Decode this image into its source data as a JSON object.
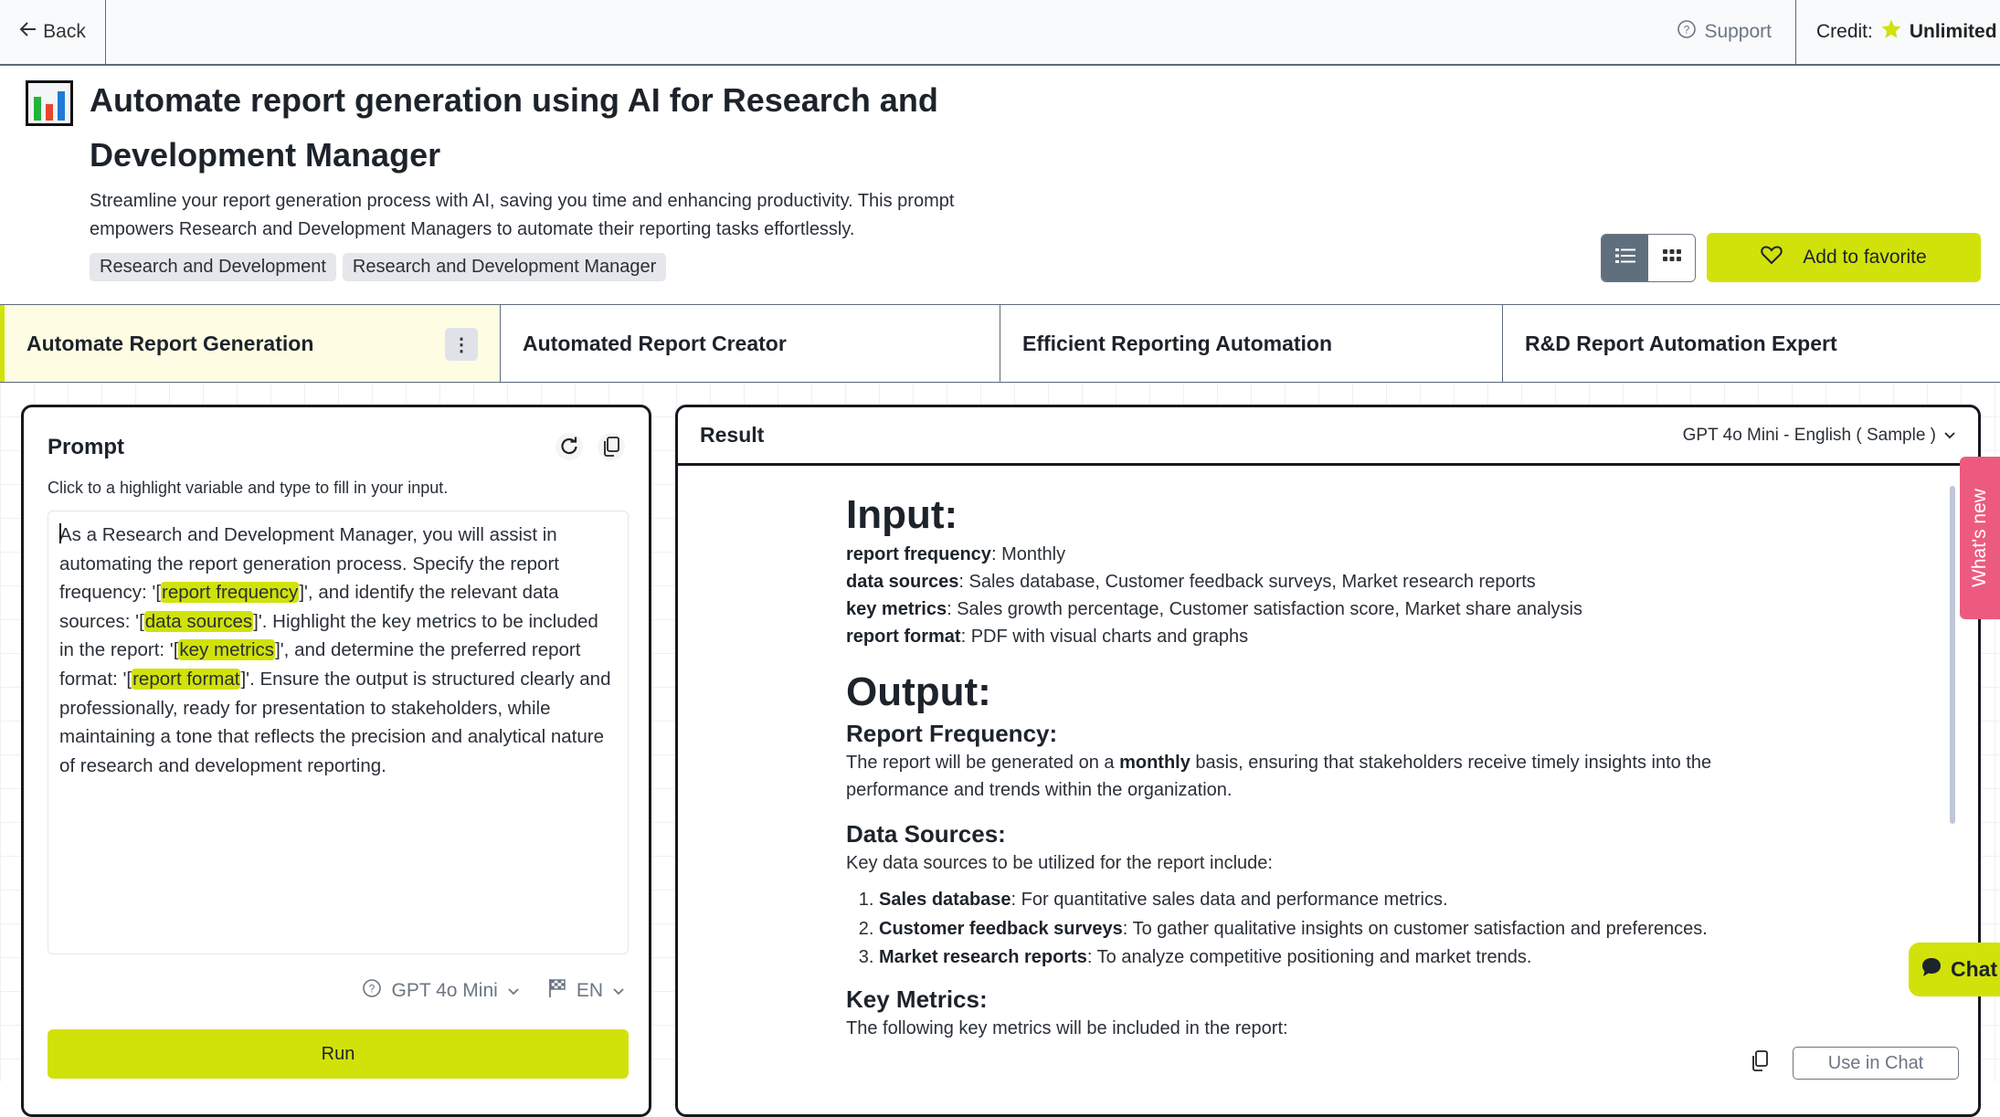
{
  "topbar": {
    "back_label": "Back",
    "support_label": "Support",
    "credit_label": "Credit:",
    "credit_value": "Unlimited"
  },
  "header": {
    "title": "Automate report generation using AI for Research and Development Manager",
    "description": "Streamline your report generation process with AI, saving you time and enhancing productivity. This prompt empowers Research and Development Managers to automate their reporting tasks effortlessly.",
    "tags": [
      "Research and Development",
      "Research and Development Manager"
    ],
    "favorite_label": "Add to favorite"
  },
  "tabs": [
    {
      "label": "Automate Report Generation",
      "active": true
    },
    {
      "label": "Automated Report Creator",
      "active": false
    },
    {
      "label": "Efficient Reporting Automation",
      "active": false
    },
    {
      "label": "R&D Report Automation Expert",
      "active": false
    }
  ],
  "prompt": {
    "title": "Prompt",
    "hint": "Click to a highlight variable and type to fill in your input.",
    "segments": [
      {
        "t": "As a Research and Development Manager, you will assist in automating the report generation process. Specify the report frequency: '["
      },
      {
        "v": "report frequency"
      },
      {
        "t": "]', and identify the relevant data sources: '["
      },
      {
        "v": "data sources"
      },
      {
        "t": "]'. Highlight the key metrics to be included in the report: '["
      },
      {
        "v": "key metrics"
      },
      {
        "t": "]', and determine the preferred report format: '["
      },
      {
        "v": "report format"
      },
      {
        "t": "]'. Ensure the output is structured clearly and professionally, ready for presentation to stakeholders, while maintaining a tone that reflects the precision and analytical nature of research and development reporting."
      }
    ],
    "model": "GPT 4o Mini",
    "language": "EN",
    "run_label": "Run"
  },
  "result": {
    "title": "Result",
    "model_selector": "GPT 4o Mini - English ( Sample )",
    "input_heading": "Input:",
    "inputs": [
      {
        "key": "report frequency",
        "value": "Monthly"
      },
      {
        "key": "data sources",
        "value": "Sales database, Customer feedback surveys, Market research reports"
      },
      {
        "key": "key metrics",
        "value": "Sales growth percentage, Customer satisfaction score, Market share analysis"
      },
      {
        "key": "report format",
        "value": "PDF with visual charts and graphs"
      }
    ],
    "output_heading": "Output:",
    "report_frequency_heading": "Report Frequency:",
    "report_frequency_pre": "The report will be generated on a ",
    "report_frequency_bold": "monthly",
    "report_frequency_post": " basis, ensuring that stakeholders receive timely insights into the performance and trends within the organization.",
    "data_sources_heading": "Data Sources:",
    "data_sources_intro": "Key data sources to be utilized for the report include:",
    "data_sources": [
      {
        "name": "Sales database",
        "desc": "For quantitative sales data and performance metrics."
      },
      {
        "name": "Customer feedback surveys",
        "desc": "To gather qualitative insights on customer satisfaction and preferences."
      },
      {
        "name": "Market research reports",
        "desc": "To analyze competitive positioning and market trends."
      }
    ],
    "key_metrics_heading": "Key Metrics:",
    "key_metrics_intro": "The following key metrics will be included in the report:",
    "use_in_chat_label": "Use in Chat"
  },
  "widgets": {
    "whats_new_label": "What's new",
    "chat_label": "Chat"
  },
  "colors": {
    "accent": "#d1e20a",
    "whats_new": "#ec5b7f"
  }
}
